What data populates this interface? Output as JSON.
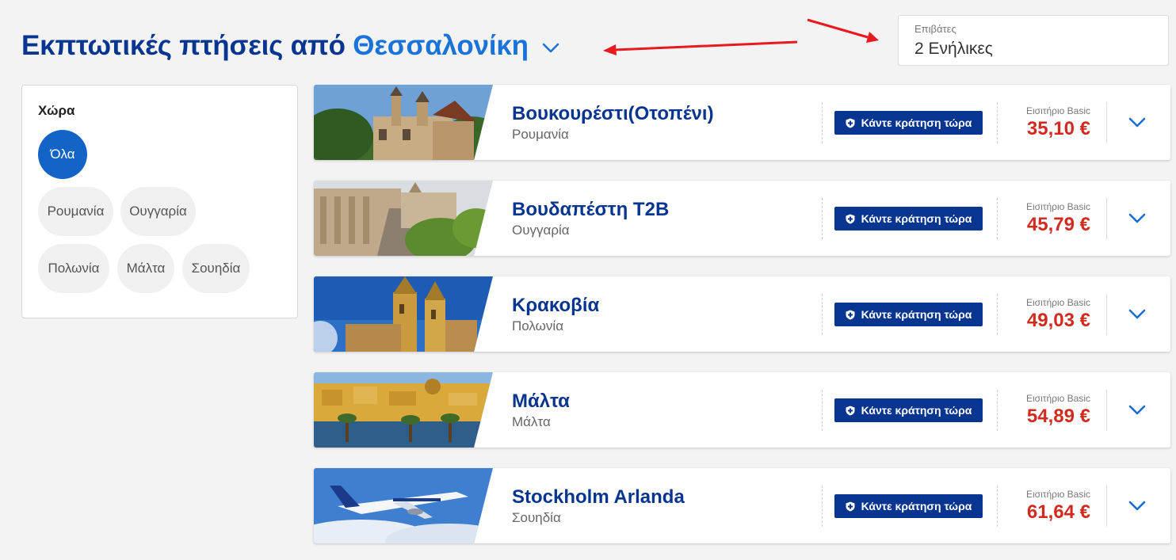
{
  "header": {
    "title_prefix": "Εκπτωτικές πτήσεις από",
    "departure_city": "Θεσσαλονίκη"
  },
  "passengers": {
    "label": "Επιβάτες",
    "value": "2 Ενήλικες"
  },
  "filter": {
    "title": "Χώρα",
    "chips": [
      {
        "label": "Όλα",
        "active": true
      },
      {
        "label": "Ρουμανία",
        "active": false
      },
      {
        "label": "Ουγγαρία",
        "active": false
      },
      {
        "label": "Πολωνία",
        "active": false
      },
      {
        "label": "Μάλτα",
        "active": false
      },
      {
        "label": "Σουηδία",
        "active": false
      }
    ]
  },
  "flights": [
    {
      "destination": "Βουκουρέστι(Οτοπένι)",
      "country": "Ρουμανία",
      "book_label": "Κάντε κράτηση τώρα",
      "fare_label": "Εισιτήριο Basic",
      "price": "35,10 €"
    },
    {
      "destination": "Βουδαπέστη T2B",
      "country": "Ουγγαρία",
      "book_label": "Κάντε κράτηση τώρα",
      "fare_label": "Εισιτήριο Basic",
      "price": "45,79 €"
    },
    {
      "destination": "Κρακοβία",
      "country": "Πολωνία",
      "book_label": "Κάντε κράτηση τώρα",
      "fare_label": "Εισιτήριο Basic",
      "price": "49,03 €"
    },
    {
      "destination": "Μάλτα",
      "country": "Μάλτα",
      "book_label": "Κάντε κράτηση τώρα",
      "fare_label": "Εισιτήριο Basic",
      "price": "54,89 €"
    },
    {
      "destination": "Stockholm Arlanda",
      "country": "Σουηδία",
      "book_label": "Κάντε κράτηση τώρα",
      "fare_label": "Εισιτήριο Basic",
      "price": "61,64 €"
    }
  ],
  "colors": {
    "brand_blue": "#073590",
    "accent_blue": "#1a73d9",
    "price_red": "#d12b1f",
    "annotation_red": "#e8191f"
  }
}
